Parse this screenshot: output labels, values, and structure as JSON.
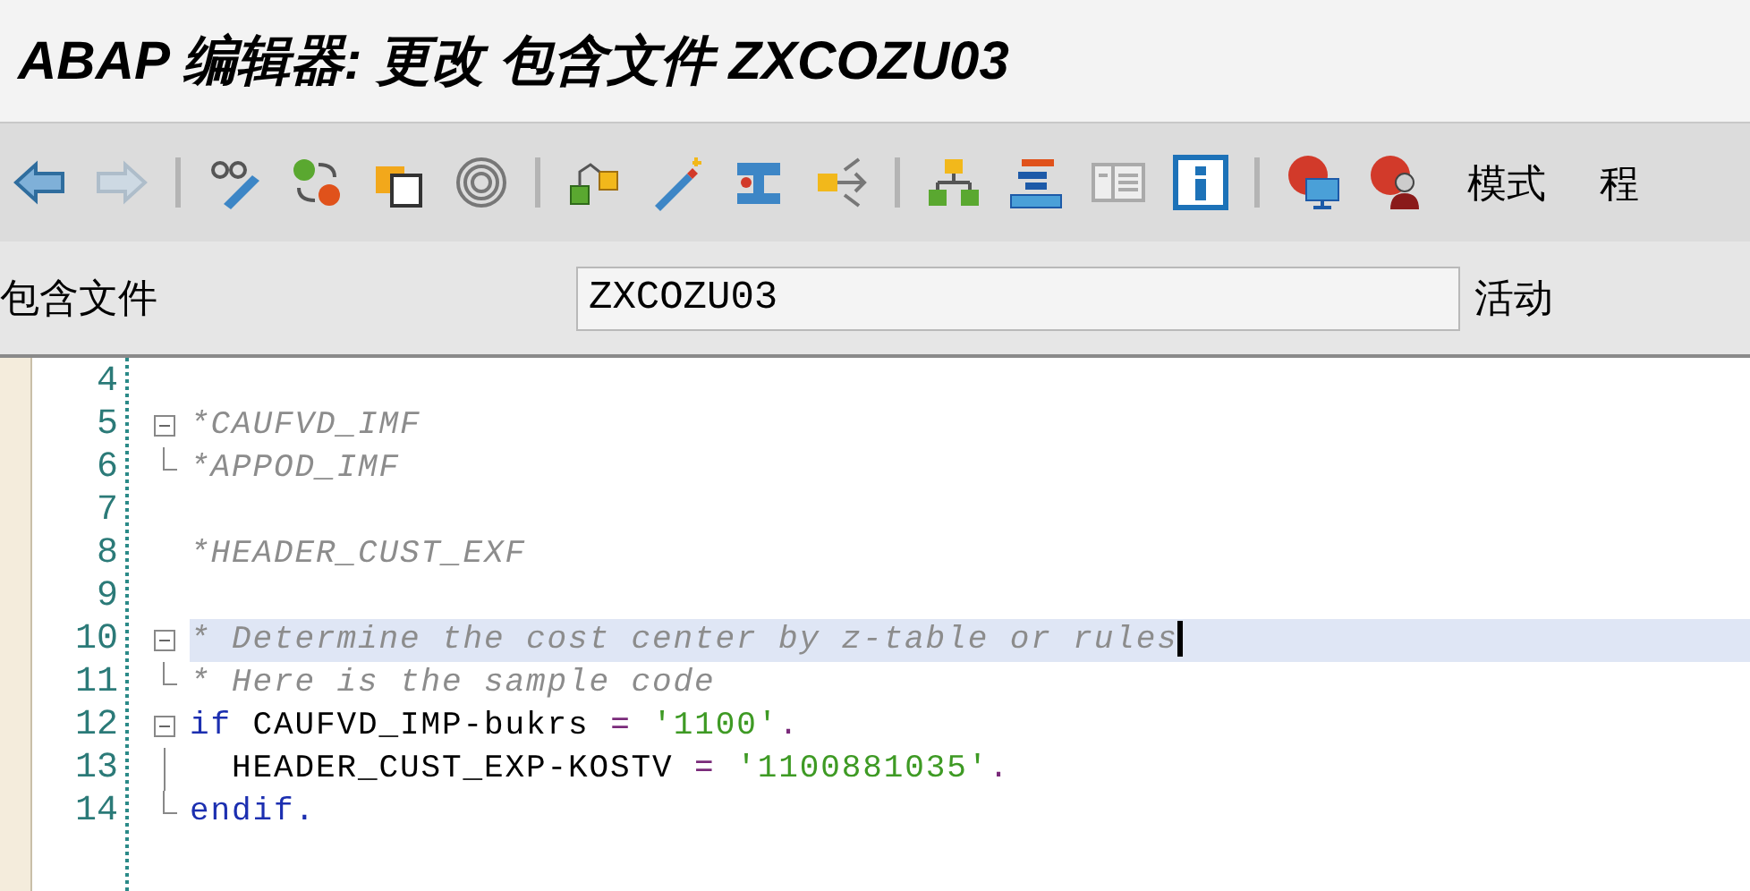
{
  "window": {
    "title": "ABAP 编辑器: 更改 包含文件 ZXCOZU03"
  },
  "toolbar": {
    "navigation": [
      {
        "disabled": false
      },
      {
        "disabled": true
      }
    ],
    "buttons": [
      "模式",
      "程"
    ]
  },
  "include": {
    "label": "包含文件",
    "value": "ZXCOZU03",
    "status": "活动"
  },
  "editor": {
    "lines": [
      {
        "number": "4",
        "kind": "plain",
        "highlighted": false
      },
      {
        "number": "5",
        "kind": "opener",
        "highlighted": false,
        "tokens": [
          {
            "kind": "comment",
            "text": "*CAUFVD_IMF"
          }
        ]
      },
      {
        "number": "6",
        "kind": "closer",
        "highlighted": false,
        "tokens": [
          {
            "kind": "comment",
            "text": "*APPOD_IMF"
          }
        ]
      },
      {
        "number": "7",
        "kind": "plain",
        "highlighted": false
      },
      {
        "number": "8",
        "kind": "plain",
        "highlighted": false,
        "tokens": [
          {
            "kind": "comment",
            "text": "*HEADER_CUST_EXF"
          }
        ]
      },
      {
        "number": "9",
        "kind": "plain",
        "highlighted": false
      },
      {
        "number": "10",
        "kind": "opener",
        "highlighted": true,
        "tokens": [
          {
            "kind": "comment",
            "text": "* Determine the cost center by z-table or rules"
          }
        ]
      },
      {
        "number": "11",
        "kind": "closer",
        "highlighted": false,
        "tokens": [
          {
            "kind": "comment",
            "text": "* Here is the sample code"
          }
        ]
      },
      {
        "number": "12",
        "kind": "opener",
        "highlighted": false,
        "tokens": [
          {
            "kind": "keyword",
            "text": "if"
          },
          {
            "kind": "plain",
            "text": " CAUFVD_IMP-bukrs "
          },
          {
            "kind": "operator",
            "text": "= "
          },
          {
            "kind": "string",
            "text": "'1100'"
          },
          {
            "kind": "operator",
            "text": "."
          }
        ]
      },
      {
        "number": "13",
        "kind": "inner",
        "highlighted": false,
        "tokens": [
          {
            "kind": "plain",
            "text": "  HEADER_CUST_EXP-KOSTV "
          },
          {
            "kind": "operator",
            "text": "= "
          },
          {
            "kind": "string",
            "text": "'1100881035'"
          },
          {
            "kind": "operator",
            "text": "."
          }
        ]
      },
      {
        "number": "14",
        "kind": "closer",
        "highlighted": false,
        "tokens": [
          {
            "kind": "keyword",
            "text": "endif."
          }
        ]
      }
    ]
  }
}
